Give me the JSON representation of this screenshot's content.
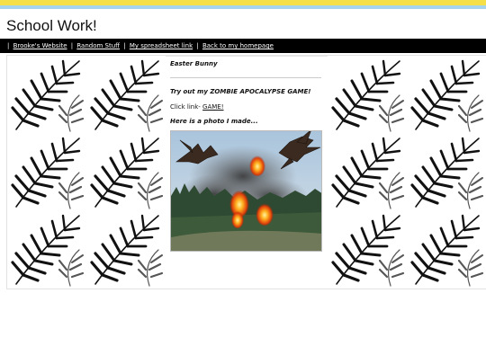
{
  "site": {
    "title": "School Work!"
  },
  "nav": {
    "leading_sep": "|",
    "links": [
      "Brooke's Website",
      "Random Stuff",
      "My spreadsheet link",
      "Back to my homepage"
    ],
    "sep": "|"
  },
  "content": {
    "heading": "Easter Bunny",
    "game_heading": "Try out my ZOMBIE APOCALYPSE GAME!",
    "click_prefix": "Click link-",
    "game_link": "GAME!",
    "photo_caption": "Here is a photo I made..."
  },
  "colors": {
    "top_stripe": "#f6e04a",
    "sub_stripe": "#a6d3ee",
    "navbar": "#000000"
  },
  "icons": {
    "pattern": "palm-leaf-pattern",
    "photo": "dragons-forest-fire-photo"
  }
}
